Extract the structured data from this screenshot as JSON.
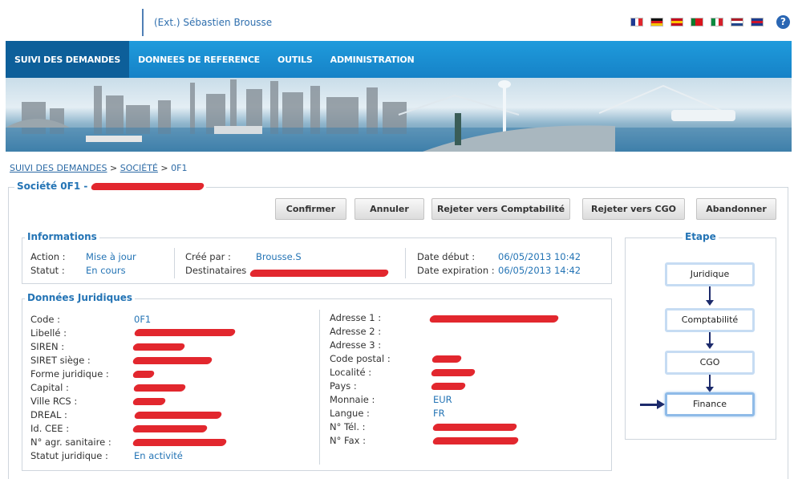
{
  "header": {
    "user": "(Ext.) Sébastien Brousse",
    "help_glyph": "?",
    "flags": [
      {
        "icon": "flag-fr-icon",
        "dir": "v",
        "colors": [
          "#1f3a93",
          "#ffffff",
          "#e1262d"
        ]
      },
      {
        "icon": "flag-de-icon",
        "dir": "h",
        "colors": [
          "#111111",
          "#d8161c",
          "#f5c400"
        ]
      },
      {
        "icon": "flag-es-icon",
        "dir": "h",
        "colors": [
          "#c60b1e",
          "#ffc400",
          "#c60b1e"
        ]
      },
      {
        "icon": "flag-pt-icon",
        "dir": "v",
        "colors": [
          "#0a7b2c",
          "#d9141c",
          "#d9141c"
        ]
      },
      {
        "icon": "flag-it-icon",
        "dir": "v",
        "colors": [
          "#0a8a3e",
          "#ffffff",
          "#d6202b"
        ]
      },
      {
        "icon": "flag-nl-icon",
        "dir": "h",
        "colors": [
          "#ae1c28",
          "#ffffff",
          "#21468b"
        ]
      },
      {
        "icon": "flag-gb-icon",
        "dir": "h",
        "colors": [
          "#1d3c8f",
          "#cf142b",
          "#1d3c8f"
        ]
      }
    ]
  },
  "nav": {
    "items": [
      "SUIVI DES DEMANDES",
      "DONNEES DE REFERENCE",
      "OUTILS",
      "ADMINISTRATION"
    ]
  },
  "breadcrumb": {
    "items": [
      "SUIVI DES DEMANDES",
      "SOCIÉTÉ",
      "0F1"
    ],
    "separator": ">"
  },
  "page": {
    "title": "Société 0F1 -"
  },
  "actions": {
    "confirm": "Confirmer",
    "cancel": "Annuler",
    "reject_accounting": "Rejeter vers Comptabilité",
    "reject_cgo": "Rejeter vers CGO",
    "abandon": "Abandonner"
  },
  "info": {
    "title": "Informations",
    "action_label": "Action :",
    "action_value": "Mise à jour",
    "status_label": "Statut :",
    "status_value": "En cours",
    "created_label": "Créé par :",
    "created_value": "Brousse.S",
    "recipients_label": "Destinataires",
    "start_label": "Date début :",
    "start_value": "06/05/2013 10:42",
    "expiry_label": "Date expiration :",
    "expiry_value": "06/05/2013 14:42"
  },
  "legal": {
    "title": "Données Juridiques",
    "left": [
      {
        "label": "Code :",
        "value": "0F1"
      },
      {
        "label": "Libellé :",
        "value": ""
      },
      {
        "label": "SIREN :",
        "value": ""
      },
      {
        "label": "SIRET siège :",
        "value": ""
      },
      {
        "label": "Forme juridique :",
        "value": ""
      },
      {
        "label": "Capital :",
        "value": ""
      },
      {
        "label": "Ville RCS :",
        "value": ""
      },
      {
        "label": "DREAL :",
        "value": ""
      },
      {
        "label": "Id. CEE :",
        "value": ""
      },
      {
        "label": "N° agr. sanitaire :",
        "value": ""
      },
      {
        "label": "Statut juridique :",
        "value": "En activité"
      }
    ],
    "right": [
      {
        "label": "Adresse 1 :",
        "value": ""
      },
      {
        "label": "Adresse 2 :",
        "value": ""
      },
      {
        "label": "Adresse 3 :",
        "value": ""
      },
      {
        "label": "Code postal :",
        "value": ""
      },
      {
        "label": "Localité :",
        "value": ""
      },
      {
        "label": "Pays :",
        "value": ""
      },
      {
        "label": "Monnaie :",
        "value": "EUR"
      },
      {
        "label": "Langue :",
        "value": "FR"
      },
      {
        "label": "N° Tél. :",
        "value": ""
      },
      {
        "label": "N° Fax :",
        "value": ""
      }
    ]
  },
  "workflow": {
    "title": "Etape",
    "steps": [
      "Juridique",
      "Comptabilité",
      "CGO",
      "Finance"
    ],
    "current": "Finance"
  },
  "colors": {
    "accent": "#2474b5",
    "nav": "#1682c7",
    "nav_active": "#0d5f9a",
    "redaction": "#e0151c"
  }
}
